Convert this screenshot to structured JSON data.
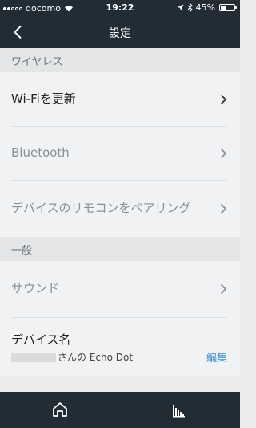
{
  "status_bar": {
    "carrier": "docomo",
    "time": "19:22",
    "battery": "45%",
    "battery_level": 0.45
  },
  "nav": {
    "title": "設定",
    "back_icon": "chevron-left-icon"
  },
  "sections": {
    "wireless": {
      "header": "ワイヤレス",
      "wifi_label": "Wi-Fiを更新",
      "bluetooth_label": "Bluetooth",
      "remote_label": "デバイスのリモコンをペアリング"
    },
    "general": {
      "header": "一般",
      "sound_label": "サウンド",
      "device_name_label": "デバイス名",
      "device_name_value": "さんの Echo Dot",
      "edit_label": "編集"
    }
  },
  "tab_bar": {
    "home_icon": "home-icon",
    "activity_icon": "equalizer-icon"
  },
  "colors": {
    "bar_bg": "#222c35",
    "page_bg": "#e9ebec",
    "link": "#3a8fd0"
  }
}
